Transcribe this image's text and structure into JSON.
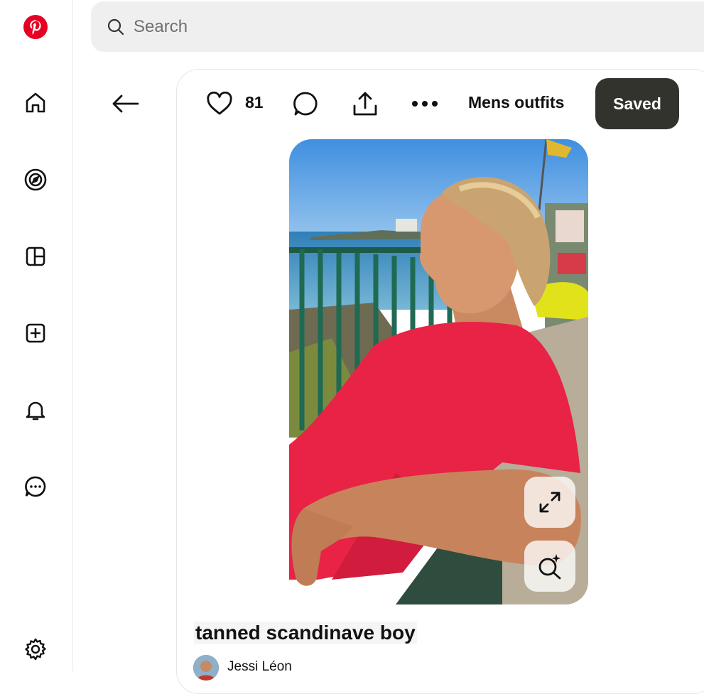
{
  "app": {
    "name": "Pinterest",
    "brand_color": "#e60023"
  },
  "rail": {
    "items": [
      {
        "name": "home",
        "icon": "home-icon"
      },
      {
        "name": "explore",
        "icon": "compass-icon"
      },
      {
        "name": "boards",
        "icon": "boards-icon"
      },
      {
        "name": "create",
        "icon": "plus-square-icon"
      },
      {
        "name": "notifications",
        "icon": "bell-icon"
      },
      {
        "name": "messages",
        "icon": "chat-icon"
      },
      {
        "name": "settings",
        "icon": "gear-icon"
      }
    ]
  },
  "search": {
    "placeholder": "Search",
    "value": ""
  },
  "pin": {
    "likes": "81",
    "board": "Mens outfits",
    "save_label": "Saved",
    "title": "tanned scandinave boy",
    "author": "Jessi Léon",
    "save_button_color": "#33332d"
  }
}
